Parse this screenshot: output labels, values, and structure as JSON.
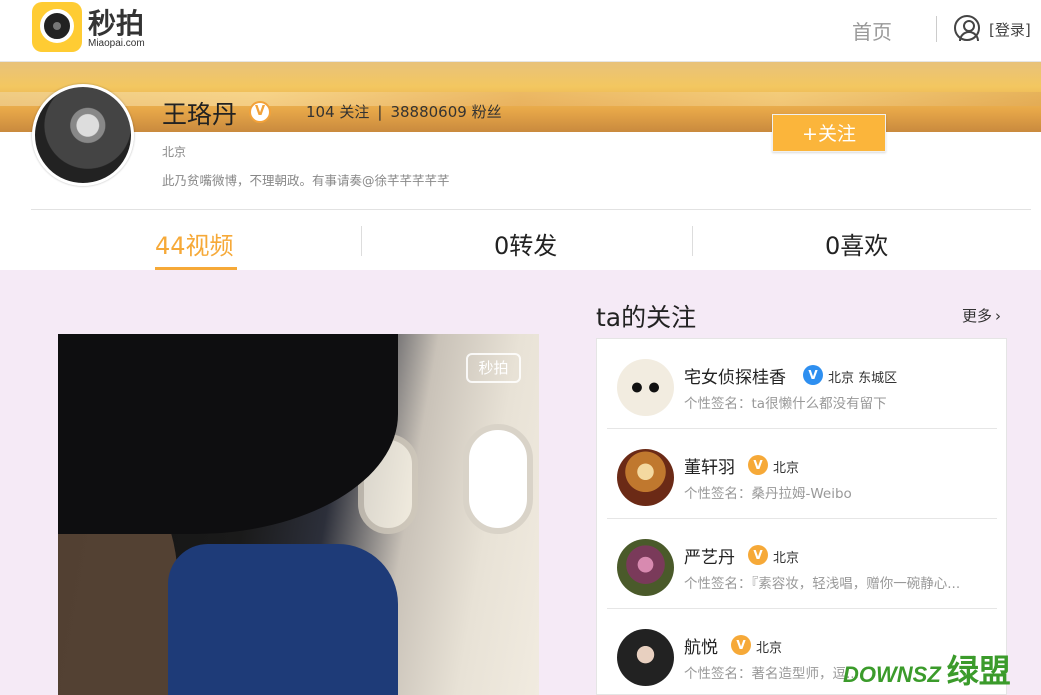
{
  "header": {
    "logo_text": "秒拍",
    "logo_sub": "Miaopai.com",
    "nav_home": "首页",
    "login": "[登录]"
  },
  "profile": {
    "name": "王珞丹",
    "verified": "V",
    "following_count": "104 关注",
    "fans_count": "38880609 粉丝",
    "separator": "|",
    "follow_button": "+关注",
    "location": "北京",
    "bio": "此乃贫嘴微博，不理朝政。有事请奏@徐芊芊芊芊芊"
  },
  "tabs": [
    {
      "label": "44视频",
      "active": true
    },
    {
      "label": "0转发",
      "active": false
    },
    {
      "label": "0喜欢",
      "active": false
    }
  ],
  "video": {
    "watermark": "秒拍"
  },
  "following_panel": {
    "title": "ta的关注",
    "more": "更多",
    "items": [
      {
        "name": "宅女侦探桂香",
        "badge": "V",
        "badge_color": "#2e8ff0",
        "location": "北京 东城区",
        "signature": "个性签名：ta很懒什么都没有留下"
      },
      {
        "name": "董轩羽",
        "badge": "V",
        "badge_color": "#f6a938",
        "location": "北京",
        "signature": "个性签名：桑丹拉姆-Weibo"
      },
      {
        "name": "严艺丹",
        "badge": "V",
        "badge_color": "#f6a938",
        "location": "北京",
        "signature": "个性签名：『素容妆，轻浅唱，赠你一碗静心..."
      },
      {
        "name": "航悦",
        "badge": "V",
        "badge_color": "#f6a938",
        "location": "北京",
        "signature": "个性签名：著名造型师，逗..."
      }
    ]
  },
  "site_watermark": {
    "text": "DOWNSZ",
    "big": "绿盟"
  }
}
